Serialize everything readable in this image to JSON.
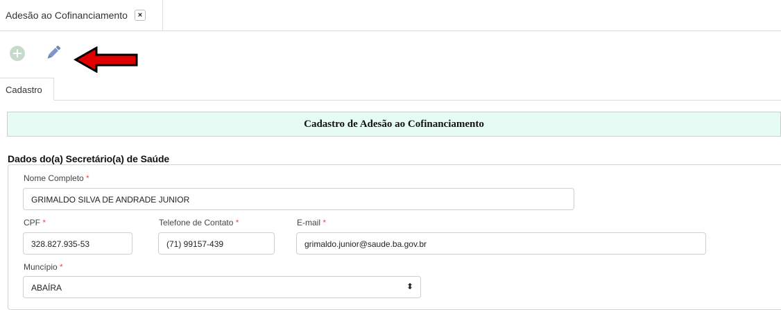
{
  "top_tab": {
    "label": "Adesão ao Cofinanciamento",
    "close": "×"
  },
  "toolbar": {
    "add_icon": "plus-circle-icon",
    "edit_icon": "pencil-icon",
    "arrow_color": "#e00000"
  },
  "sub_tab": {
    "label": "Cadastro"
  },
  "form": {
    "header": "Cadastro de Adesão ao Cofinanciamento",
    "header_bg": "#e6fbf4",
    "section": "Dados do(a) Secretário(a) de Saúde",
    "required_mark": "*",
    "fields": {
      "nome": {
        "label": "Nome Completo",
        "value": "GRIMALDO SILVA DE ANDRADE JUNIOR"
      },
      "cpf": {
        "label": "CPF",
        "value": "328.827.935-53"
      },
      "telefone": {
        "label": "Telefone de Contato",
        "value": "(71) 99157-439"
      },
      "email": {
        "label": "E-mail",
        "value": "grimaldo.junior@saude.ba.gov.br"
      },
      "municipio": {
        "label": "Muncípio",
        "value": "ABAÍRA",
        "caret": "⬍"
      }
    }
  }
}
